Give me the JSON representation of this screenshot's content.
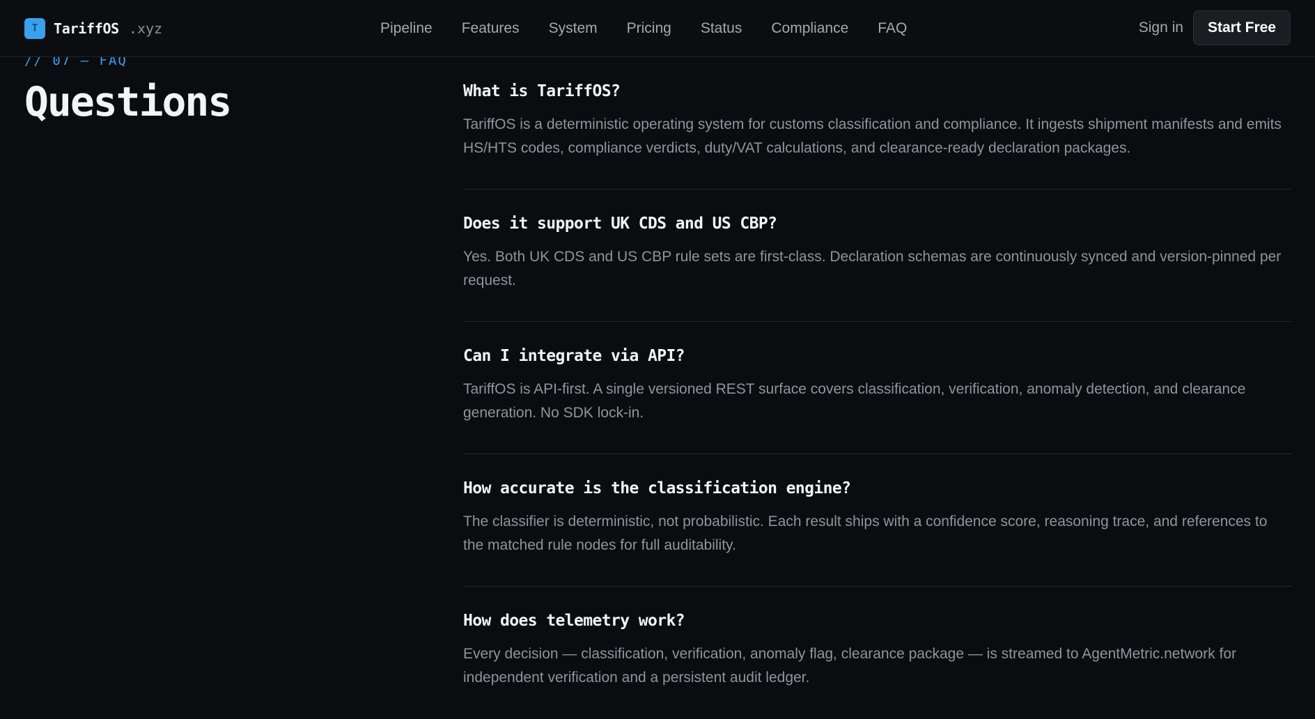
{
  "brand": {
    "logo_letter": "T",
    "name": "TariffOS",
    "tld": ".xyz"
  },
  "nav": {
    "links": [
      "Pipeline",
      "Features",
      "System",
      "Pricing",
      "Status",
      "Compliance",
      "FAQ"
    ],
    "signin": "Sign in",
    "start": "Start Free"
  },
  "section": {
    "tag": "// 07 — FAQ",
    "title": "Questions"
  },
  "faq": [
    {
      "q": "What is TariffOS?",
      "a": "TariffOS is a deterministic operating system for customs classification and compliance. It ingests shipment manifests and emits HS/HTS codes, compliance verdicts, duty/VAT calculations, and clearance-ready declaration packages."
    },
    {
      "q": "Does it support UK CDS and US CBP?",
      "a": "Yes. Both UK CDS and US CBP rule sets are first-class. Declaration schemas are continuously synced and version-pinned per request."
    },
    {
      "q": "Can I integrate via API?",
      "a": "TariffOS is API-first. A single versioned REST surface covers classification, verification, anomaly detection, and clearance generation. No SDK lock-in."
    },
    {
      "q": "How accurate is the classification engine?",
      "a": "The classifier is deterministic, not probabilistic. Each result ships with a confidence score, reasoning trace, and references to the matched rule nodes for full auditability."
    },
    {
      "q": "How does telemetry work?",
      "a": "Every decision — classification, verification, anomaly flag, clearance package — is streamed to AgentMetric.network for independent verification and a persistent audit ledger."
    }
  ],
  "colors": {
    "background": "#0a0c0f",
    "accent": "#3aa0f0",
    "muted_text": "#8f959e"
  }
}
